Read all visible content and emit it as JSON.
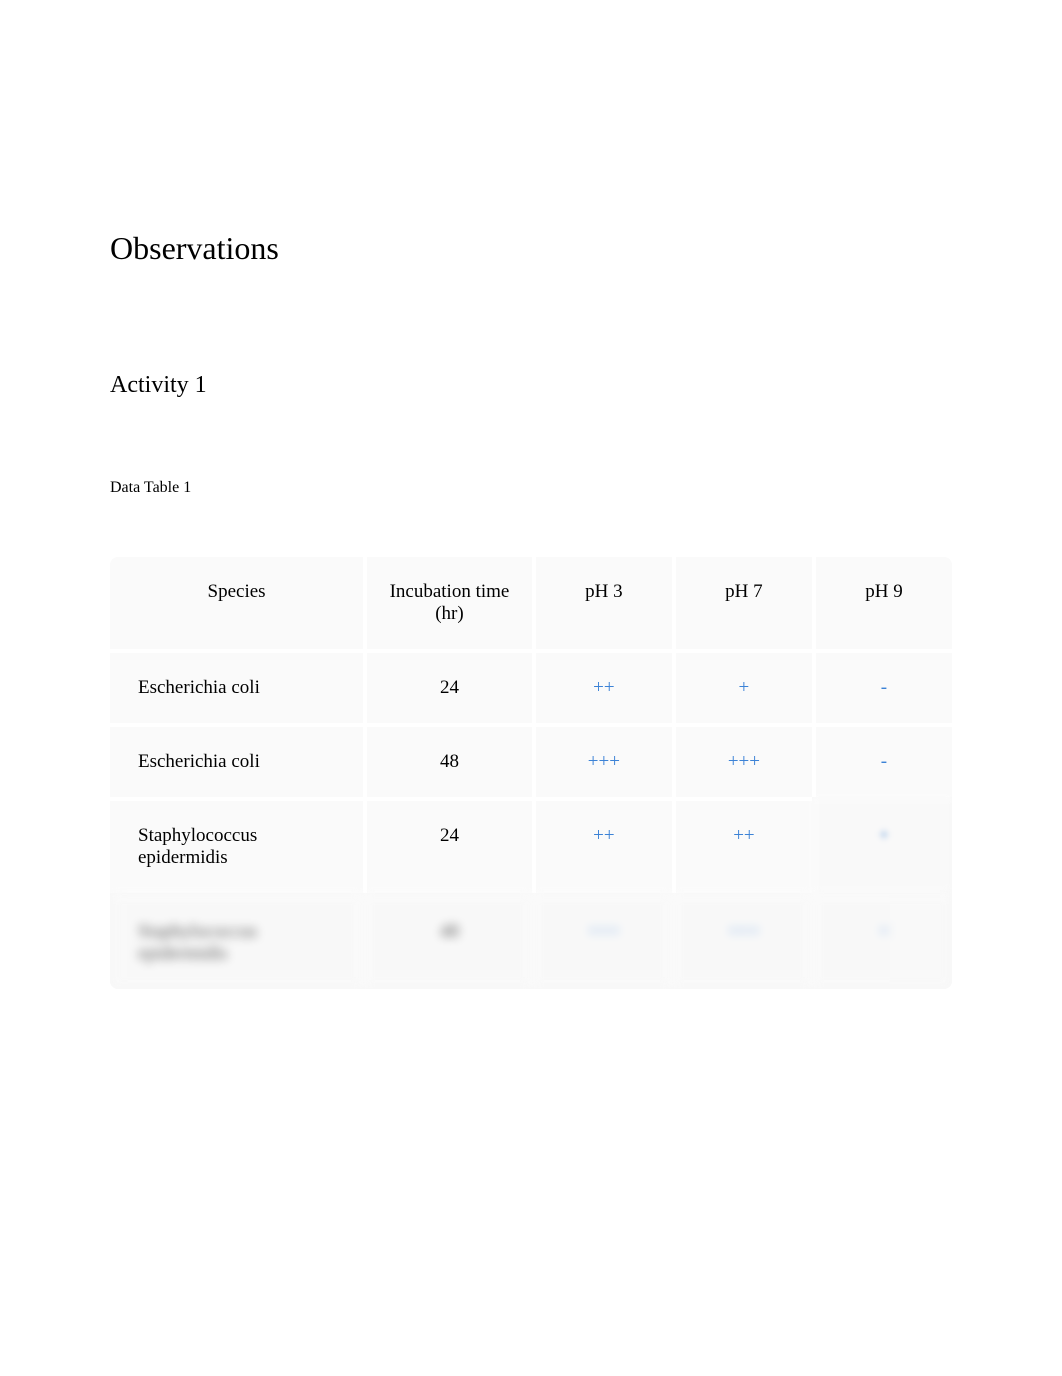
{
  "headings": {
    "section": "Observations",
    "activity": "Activity 1",
    "table_caption": "Data Table 1"
  },
  "table": {
    "headers": {
      "species": "Species",
      "incubation": "Incubation time (hr)",
      "ph3": "pH 3",
      "ph7": "pH 7",
      "ph9": "pH 9"
    },
    "rows": [
      {
        "species": "Escherichia coli",
        "incubation": "24",
        "ph3": "++",
        "ph7": "+",
        "ph9": "-"
      },
      {
        "species": "Escherichia coli",
        "incubation": "48",
        "ph3": "+++",
        "ph7": "+++",
        "ph9": "-"
      },
      {
        "species": "Staphylococcus epidermidis",
        "incubation": "24",
        "ph3": "++",
        "ph7": "++",
        "ph9": "+"
      },
      {
        "species": "Staphylococcus epidermidis",
        "incubation": "48",
        "ph3": "+++",
        "ph7": "+++",
        "ph9": "+"
      }
    ]
  }
}
